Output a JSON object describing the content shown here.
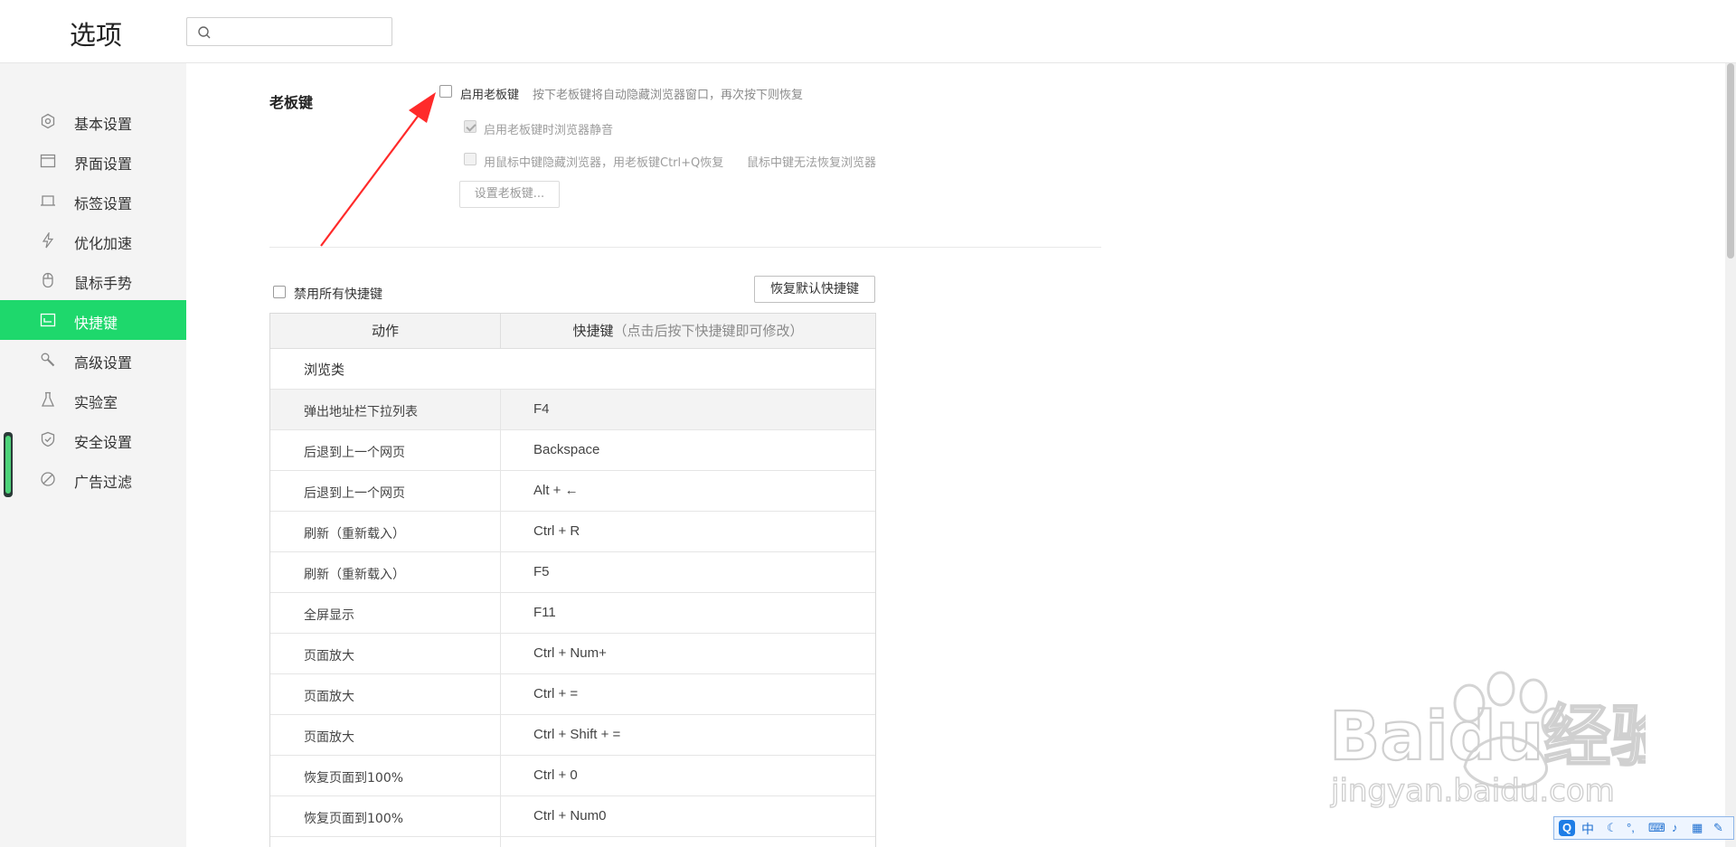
{
  "header": {
    "title": "选项",
    "search": {
      "value": "",
      "placeholder": ""
    }
  },
  "sidebar": {
    "items": [
      {
        "label": "基本设置",
        "icon": "gear-icon"
      },
      {
        "label": "界面设置",
        "icon": "window-icon"
      },
      {
        "label": "标签设置",
        "icon": "tab-icon"
      },
      {
        "label": "优化加速",
        "icon": "lightning-icon"
      },
      {
        "label": "鼠标手势",
        "icon": "mouse-icon"
      },
      {
        "label": "快捷键",
        "icon": "keyboard-icon",
        "active": true
      },
      {
        "label": "高级设置",
        "icon": "wrench-icon"
      },
      {
        "label": "实验室",
        "icon": "flask-icon"
      },
      {
        "label": "安全设置",
        "icon": "shield-icon"
      },
      {
        "label": "广告过滤",
        "icon": "block-icon"
      }
    ],
    "active_color": "#1ed86c"
  },
  "boss_key": {
    "section_title": "老板键",
    "enable_label": "启用老板键",
    "enable_hint": "按下老板键将自动隐藏浏览器窗口，再次按下则恢复",
    "mute_label": "启用老板键时浏览器静音",
    "middle_click_label": "用鼠标中键隐藏浏览器，用老板键Ctrl+Q恢复",
    "middle_click_hint": "鼠标中键无法恢复浏览器",
    "set_button": "设置老板键..."
  },
  "shortcuts": {
    "disable_all_label": "禁用所有快捷键",
    "restore_button": "恢复默认快捷键",
    "col_action": "动作",
    "col_shortcut": "快捷键",
    "col_shortcut_hint": "（点击后按下快捷键即可修改）",
    "group_name": "浏览类",
    "rows": [
      {
        "action": "弹出地址栏下拉列表",
        "key": "F4"
      },
      {
        "action": "后退到上一个网页",
        "key": "Backspace"
      },
      {
        "action": "后退到上一个网页",
        "key": "Alt + ←"
      },
      {
        "action": "刷新（重新载入）",
        "key": "Ctrl + R"
      },
      {
        "action": "刷新（重新载入）",
        "key": "F5"
      },
      {
        "action": "全屏显示",
        "key": "F11"
      },
      {
        "action": "页面放大",
        "key": "Ctrl + Num+"
      },
      {
        "action": "页面放大",
        "key": "Ctrl + ="
      },
      {
        "action": "页面放大",
        "key": "Ctrl + Shift + ="
      },
      {
        "action": "恢复页面到100%",
        "key": "Ctrl + 0"
      },
      {
        "action": "恢复页面到100%",
        "key": "Ctrl + Num0"
      }
    ]
  },
  "watermark": {
    "brand": "Baidu经验",
    "url": "jingyan.baidu.com"
  },
  "ime_toolbar": {
    "logo": "Q",
    "mode": "中"
  },
  "colors": {
    "accent_green": "#1ed86c",
    "annotation_red": "#ff2a2a"
  }
}
